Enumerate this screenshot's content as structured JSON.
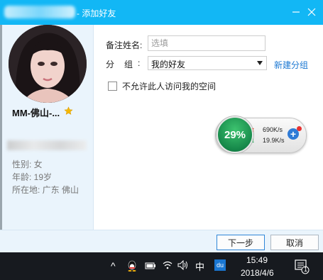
{
  "window": {
    "title": "- 添加好友"
  },
  "profile": {
    "nickname": "MM-佛山-...",
    "gender": "性别: 女",
    "age": "年龄: 19岁",
    "location": "所在地: 广东  佛山"
  },
  "form": {
    "remark_label": "备注姓名:",
    "remark_placeholder": "选填",
    "remark_value": "",
    "group_label": "分组",
    "group_colon": ":",
    "group_selected": "我的好友",
    "new_group_link": "新建分组",
    "deny_visit_label": "不允许此人访问我的空间",
    "deny_visit_checked": false
  },
  "speed_widget": {
    "percent": "29%",
    "upload": "690K/s",
    "download": "19.9K/s"
  },
  "buttons": {
    "next": "下一步",
    "cancel": "取消"
  },
  "taskbar": {
    "chevron": "^",
    "input_lang": "中",
    "du_label": "du",
    "time": "15:49",
    "date": "2018/4/6",
    "notification_count": "1"
  },
  "colors": {
    "title_bar": "#12b7f5",
    "link": "#1a77d2",
    "taskbar": "#171a1f",
    "speed_green": "#16884a"
  }
}
